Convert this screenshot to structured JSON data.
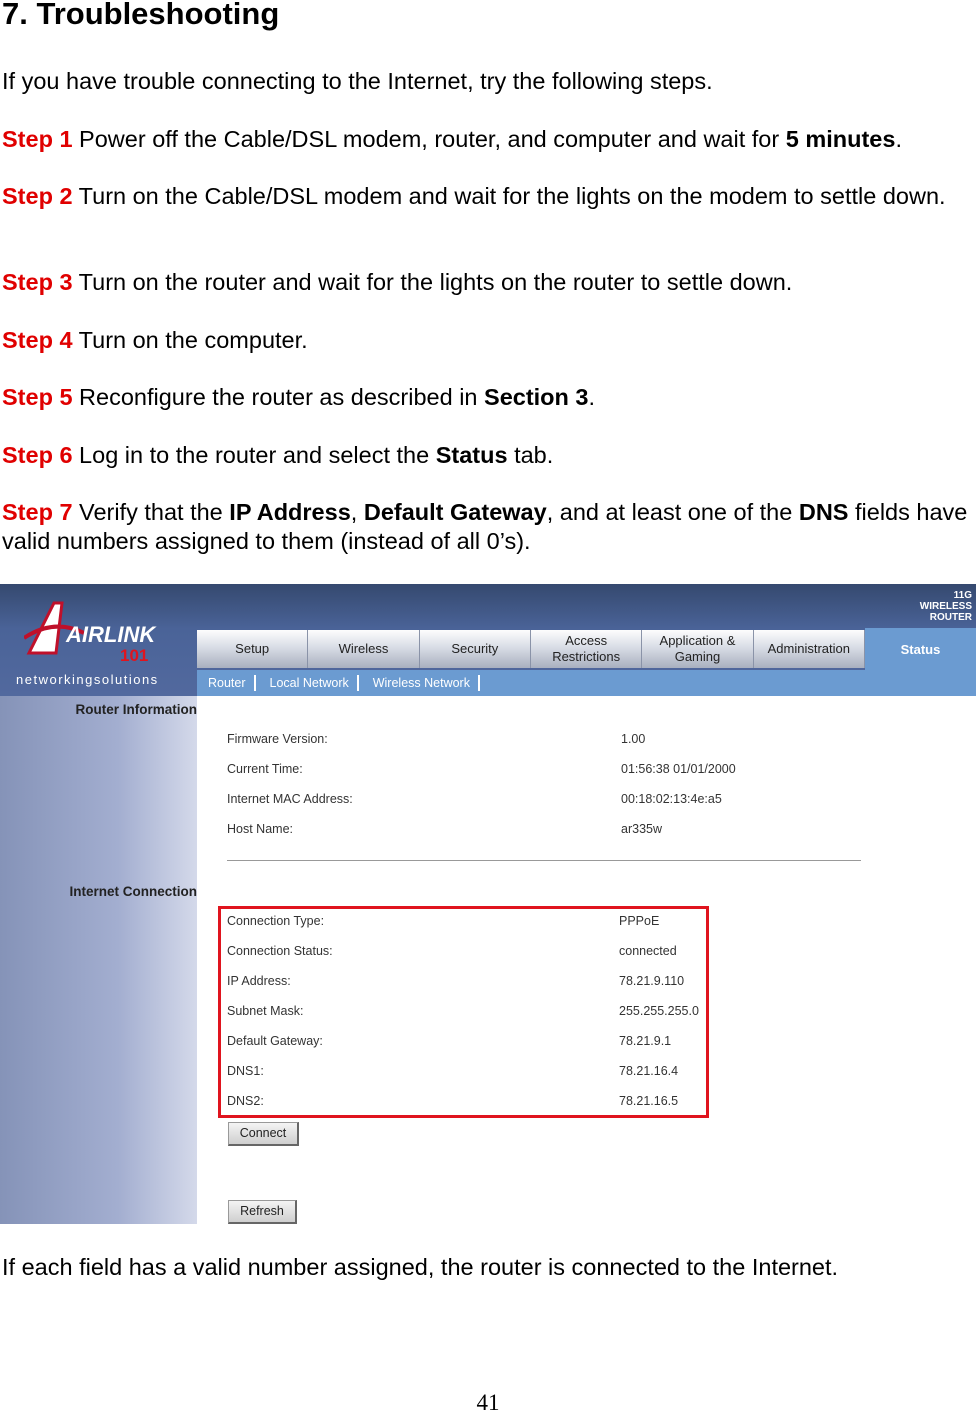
{
  "heading": "7. Troubleshooting",
  "intro": "If you have trouble connecting to the Internet, try the following steps.",
  "steps": [
    {
      "label": "Step 1",
      "parts": [
        {
          "t": " Power off the Cable/DSL modem, router, and computer and wait for "
        },
        {
          "t": "5 minutes",
          "b": true
        },
        {
          "t": "."
        }
      ]
    },
    {
      "label": "Step 2",
      "parts": [
        {
          "t": " Turn on the Cable/DSL modem and wait for the lights on the modem to settle down."
        }
      ]
    },
    {
      "label": "Step 3",
      "parts": [
        {
          "t": " Turn on the router and wait for the lights on the router to settle down."
        }
      ]
    },
    {
      "label": "Step 4",
      "parts": [
        {
          "t": " Turn on the computer."
        }
      ]
    },
    {
      "label": "Step 5",
      "parts": [
        {
          "t": " Reconfigure the router as described in "
        },
        {
          "t": "Section 3",
          "b": true
        },
        {
          "t": "."
        }
      ]
    },
    {
      "label": "Step 6",
      "parts": [
        {
          "t": " Log in to the router and select the "
        },
        {
          "t": "Status",
          "b": true
        },
        {
          "t": " tab."
        }
      ]
    },
    {
      "label": "Step 7",
      "parts": [
        {
          "t": " Verify that the "
        },
        {
          "t": "IP Address",
          "b": true
        },
        {
          "t": ", "
        },
        {
          "t": "Default Gateway",
          "b": true
        },
        {
          "t": ", and at least one of the "
        },
        {
          "t": "DNS",
          "b": true
        },
        {
          "t": " fields have valid numbers assigned to them (instead of all 0’s)."
        }
      ]
    }
  ],
  "router_ui": {
    "logo": {
      "brand": "AIRLINK",
      "brand_num": "101",
      "tagline": "networkingsolutions",
      "badge": "11G WIRELESS ROUTER"
    },
    "tabs": [
      "Setup",
      "Wireless",
      "Security",
      "Access Restrictions",
      "Application & Gaming",
      "Administration"
    ],
    "active_tab": "Status",
    "subtabs": [
      "Router",
      "Local Network",
      "Wireless Network"
    ],
    "sections": {
      "router_info": "Router Information",
      "internet": "Internet Connection"
    },
    "router_info": [
      {
        "label": "Firmware Version:",
        "value": "1.00"
      },
      {
        "label": "Current Time:",
        "value": "01:56:38 01/01/2000"
      },
      {
        "label": "Internet MAC Address:",
        "value": "00:18:02:13:4e:a5"
      },
      {
        "label": "Host Name:",
        "value": "ar335w"
      }
    ],
    "internet": [
      {
        "label": "Connection Type:",
        "value": "PPPoE"
      },
      {
        "label": "Connection Status:",
        "value": "connected"
      },
      {
        "label": "IP Address:",
        "value": "78.21.9.110"
      },
      {
        "label": "Subnet Mask:",
        "value": "255.255.255.0"
      },
      {
        "label": "Default Gateway:",
        "value": "78.21.9.1"
      },
      {
        "label": "DNS1:",
        "value": "78.21.16.4"
      },
      {
        "label": "DNS2:",
        "value": "78.21.16.5"
      }
    ],
    "connect_button": "Connect",
    "refresh_button": "Refresh",
    "highlight_color": "#e0141e"
  },
  "conclusion": "If each field has a valid number assigned, the router is connected to the Internet.",
  "page_number": "41"
}
